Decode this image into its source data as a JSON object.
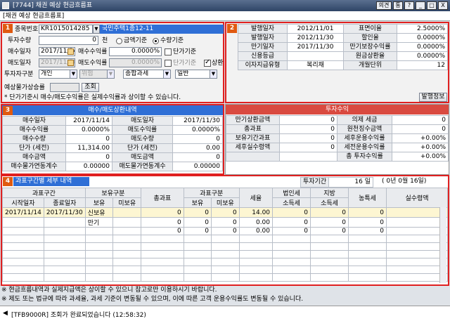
{
  "window": {
    "title": "[7744] 채권 예상 현금흐름표",
    "buttons": [
      "의견",
      "통",
      "?",
      "_",
      "□",
      "X"
    ]
  },
  "subtitle": "[채권 예상 현금흐름표]",
  "sec1": {
    "num": "1",
    "code_label": "종목번호",
    "code_value": "KR1015014285",
    "bond_name": "국민주택1종12-11",
    "qty_label": "투자수량",
    "qty_value": "0",
    "qty_unit": "천",
    "radio_amount": "금액기준",
    "radio_qty": "수량기준",
    "buy_date_label": "매수일자",
    "buy_date": "2017/11/14",
    "buy_yield_label": "매수수익률",
    "buy_yield": "0.0000%",
    "unit_price_label": "단가기준",
    "sell_date_label": "매도일자",
    "sell_date": "2017/11/30",
    "sell_yield_label": "매도수익률",
    "sell_yield": "0.0000%",
    "unit_price_label2": "단가기준",
    "repay_label": "상환",
    "investor_label": "투자자구분",
    "investor": "개인",
    "risk": "위험",
    "tax": "종합과세",
    "general": "일반",
    "expected_label": "예상물가상승률",
    "query_button": "조회",
    "note": "* 단가기준시 매수/매도수익률은 실제수익률과 상이할 수 있습니다."
  },
  "sec2": {
    "num": "2",
    "rows": [
      [
        "발행일자",
        "2012/11/01",
        "표면이율",
        "2.5000%"
      ],
      [
        "발행일자",
        "2012/11/30",
        "할인율",
        "0.0000%"
      ],
      [
        "만기일자",
        "2017/11/30",
        "만기보장수익률",
        "0.0000%"
      ],
      [
        "신용등급",
        "",
        "원금상환율",
        "0.0000%"
      ],
      [
        "이자지급유형",
        "복리채",
        "개월단위",
        "12"
      ]
    ],
    "info_button": "발행정보"
  },
  "sec3": {
    "num": "3",
    "header": "매수/매도상환내역",
    "rows": [
      [
        "매수일자",
        "2017/11/14",
        "매도일자",
        "2017/11/30"
      ],
      [
        "매수수익률",
        "0.0000%",
        "매도수익률",
        "0.0000%"
      ],
      [
        "매수수량",
        "0",
        "매도수량",
        "0"
      ],
      [
        "단가  (세전)",
        "11,314.00",
        "단가  (세전)",
        "0.00"
      ],
      [
        "매수금액",
        "0",
        "매도금액",
        "0"
      ],
      [
        "매수물가연동계수",
        "0.00000",
        "매도물가연동계수",
        "0.00000"
      ]
    ]
  },
  "sec_profit": {
    "header": "투자수익",
    "rows": [
      [
        "만기상환금액",
        "0",
        "의제 세금",
        "0"
      ],
      [
        "총과표",
        "0",
        "원천징수금액",
        "0"
      ],
      [
        "보유기간과표",
        "0",
        "세후운용수익률",
        "+0.00%"
      ],
      [
        "세후실수령액",
        "0",
        "세전운용수익률",
        "+0.00%"
      ],
      [
        "",
        "",
        "총 투자수익률",
        "+0.00%"
      ]
    ]
  },
  "sec4": {
    "num": "4",
    "title": "과표구간별 세부 내역",
    "period_label": "투자기간",
    "period_days": "16 일",
    "period_detail": "( 0년   0월 16일)",
    "headers": {
      "range": "과표구간",
      "start": "시작일자",
      "end": "종료일자",
      "hold": "보유구분",
      "hold_own": "보유",
      "hold_not": "미보유",
      "total": "총과표",
      "range2": "과표구분",
      "own2": "보유",
      "not2": "미보유",
      "rate": "세율",
      "corp": "법인세",
      "corp2": "소득세",
      "local": "지방",
      "local2": "소득세",
      "farm": "농특세",
      "real": "실수령액"
    },
    "rows": [
      [
        "2017/11/14",
        "2017/11/30",
        "신보유",
        "",
        "0",
        "0",
        "0",
        "14.00",
        "0",
        "0",
        "0",
        "0"
      ],
      [
        "",
        "",
        "만기",
        "",
        "0",
        "0",
        "0",
        "0.00",
        "0",
        "0",
        "0",
        "0"
      ],
      [
        "",
        "",
        "",
        "",
        "0",
        "0",
        "0",
        "0.00",
        "0",
        "0",
        "0",
        "0"
      ]
    ]
  },
  "footer": {
    "note1": "※ 현금흐름내역과 실제지급액은 상이할 수 있으니 참고로만 이용하시기 바랍니다.",
    "note2": "※ 제도 또는 법규에 따라 과세율, 과세 기준이 변동될 수 있으며, 이에 따른 고객 운용수익률도 변동될 수 있습니다.",
    "status": "[TFB9000R] 조회가 완료되었습니다 (12:58:32)"
  }
}
